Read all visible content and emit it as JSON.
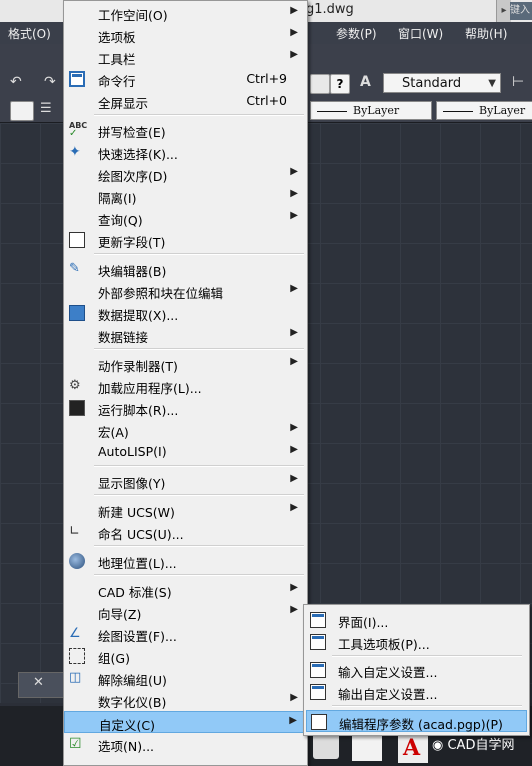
{
  "window": {
    "title_fragment": "g1.dwg",
    "search_fragment": "键入"
  },
  "menubar": [
    {
      "label": "格式(O)"
    },
    {
      "label": "参数(P)"
    },
    {
      "label": "窗口(W)"
    },
    {
      "label": "帮助(H)"
    }
  ],
  "toolbar": {
    "text_style": "Standard",
    "linetype": "ByLayer",
    "lineweight": "ByLayer"
  },
  "context_menu": {
    "items": [
      {
        "label": "工作空间(O)",
        "submenu": true
      },
      {
        "label": "选项板",
        "submenu": true
      },
      {
        "label": "工具栏",
        "submenu": true
      },
      {
        "label": "命令行",
        "shortcut": "Ctrl+9",
        "icon": "command-line-icon"
      },
      {
        "label": "全屏显示",
        "shortcut": "Ctrl+0"
      },
      {
        "label": "拼写检查(E)",
        "icon": "spellcheck-icon"
      },
      {
        "label": "快速选择(K)...",
        "icon": "quick-select-icon"
      },
      {
        "label": "绘图次序(D)",
        "submenu": true
      },
      {
        "label": "隔离(I)",
        "submenu": true
      },
      {
        "label": "查询(Q)",
        "submenu": true
      },
      {
        "label": "更新字段(T)",
        "icon": "update-field-icon"
      },
      {
        "label": "块编辑器(B)",
        "icon": "block-editor-icon"
      },
      {
        "label": "外部参照和块在位编辑",
        "submenu": true
      },
      {
        "label": "数据提取(X)...",
        "icon": "data-extraction-icon"
      },
      {
        "label": "数据链接",
        "submenu": true
      },
      {
        "label": "动作录制器(T)",
        "submenu": true
      },
      {
        "label": "加载应用程序(L)...",
        "icon": "load-application-icon"
      },
      {
        "label": "运行脚本(R)...",
        "icon": "run-script-icon"
      },
      {
        "label": "宏(A)",
        "submenu": true
      },
      {
        "label": "AutoLISP(I)",
        "submenu": true
      },
      {
        "label": "显示图像(Y)",
        "submenu": true
      },
      {
        "label": "新建 UCS(W)",
        "submenu": true
      },
      {
        "label": "命名 UCS(U)...",
        "icon": "named-ucs-icon"
      },
      {
        "label": "地理位置(L)...",
        "icon": "geolocation-icon"
      },
      {
        "label": "CAD 标准(S)",
        "submenu": true
      },
      {
        "label": "向导(Z)",
        "submenu": true
      },
      {
        "label": "绘图设置(F)...",
        "icon": "drafting-settings-icon"
      },
      {
        "label": "组(G)",
        "icon": "group-icon"
      },
      {
        "label": "解除编组(U)",
        "icon": "ungroup-icon"
      },
      {
        "label": "数字化仪(B)",
        "submenu": true
      },
      {
        "label": "自定义(C)",
        "submenu": true,
        "highlighted": true
      },
      {
        "label": "选项(N)...",
        "icon": "options-icon"
      }
    ]
  },
  "submenu": {
    "items": [
      {
        "label": "界面(I)...",
        "icon": "interface-icon"
      },
      {
        "label": "工具选项板(P)...",
        "icon": "tool-palettes-icon"
      },
      {
        "label": "输入自定义设置...",
        "icon": "import-customization-icon"
      },
      {
        "label": "输出自定义设置...",
        "icon": "export-customization-icon"
      },
      {
        "label": "编辑程序参数 (acad.pgp)(P)",
        "icon": "edit-pgp-icon",
        "highlighted": true
      }
    ]
  },
  "watermark": "CAD自学网"
}
